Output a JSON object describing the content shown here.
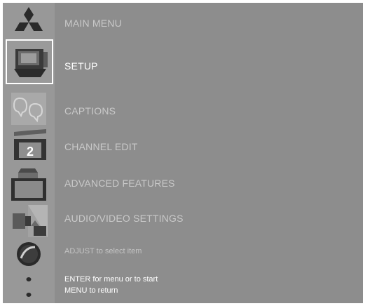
{
  "menu": {
    "title": "MAIN MENU",
    "items": [
      {
        "label": "SETUP",
        "icon": "tv-setup-icon",
        "selected": true
      },
      {
        "label": "CAPTIONS",
        "icon": "captions-icon",
        "selected": false
      },
      {
        "label": "CHANNEL EDIT",
        "icon": "channel-edit-icon",
        "selected": false
      },
      {
        "label": "ADVANCED FEATURES",
        "icon": "advanced-features-icon",
        "selected": false
      },
      {
        "label": "AUDIO/VIDEO SETTINGS",
        "icon": "audio-video-icon",
        "selected": false
      }
    ]
  },
  "hints": {
    "adjust": "ADJUST to select item",
    "enter": "ENTER for menu or to start",
    "menu": "MENU to return"
  },
  "icons": {
    "logo": "three-diamond-logo",
    "adjust": "adjust-knob-icon",
    "enter": "enter-dots-icon"
  },
  "channel_number": "2",
  "colors": {
    "background": "#8d8d8d",
    "rail": "#989898",
    "active_text": "#ffffff",
    "inactive_text": "#c9c9c9",
    "selection_border": "#ffffff"
  }
}
